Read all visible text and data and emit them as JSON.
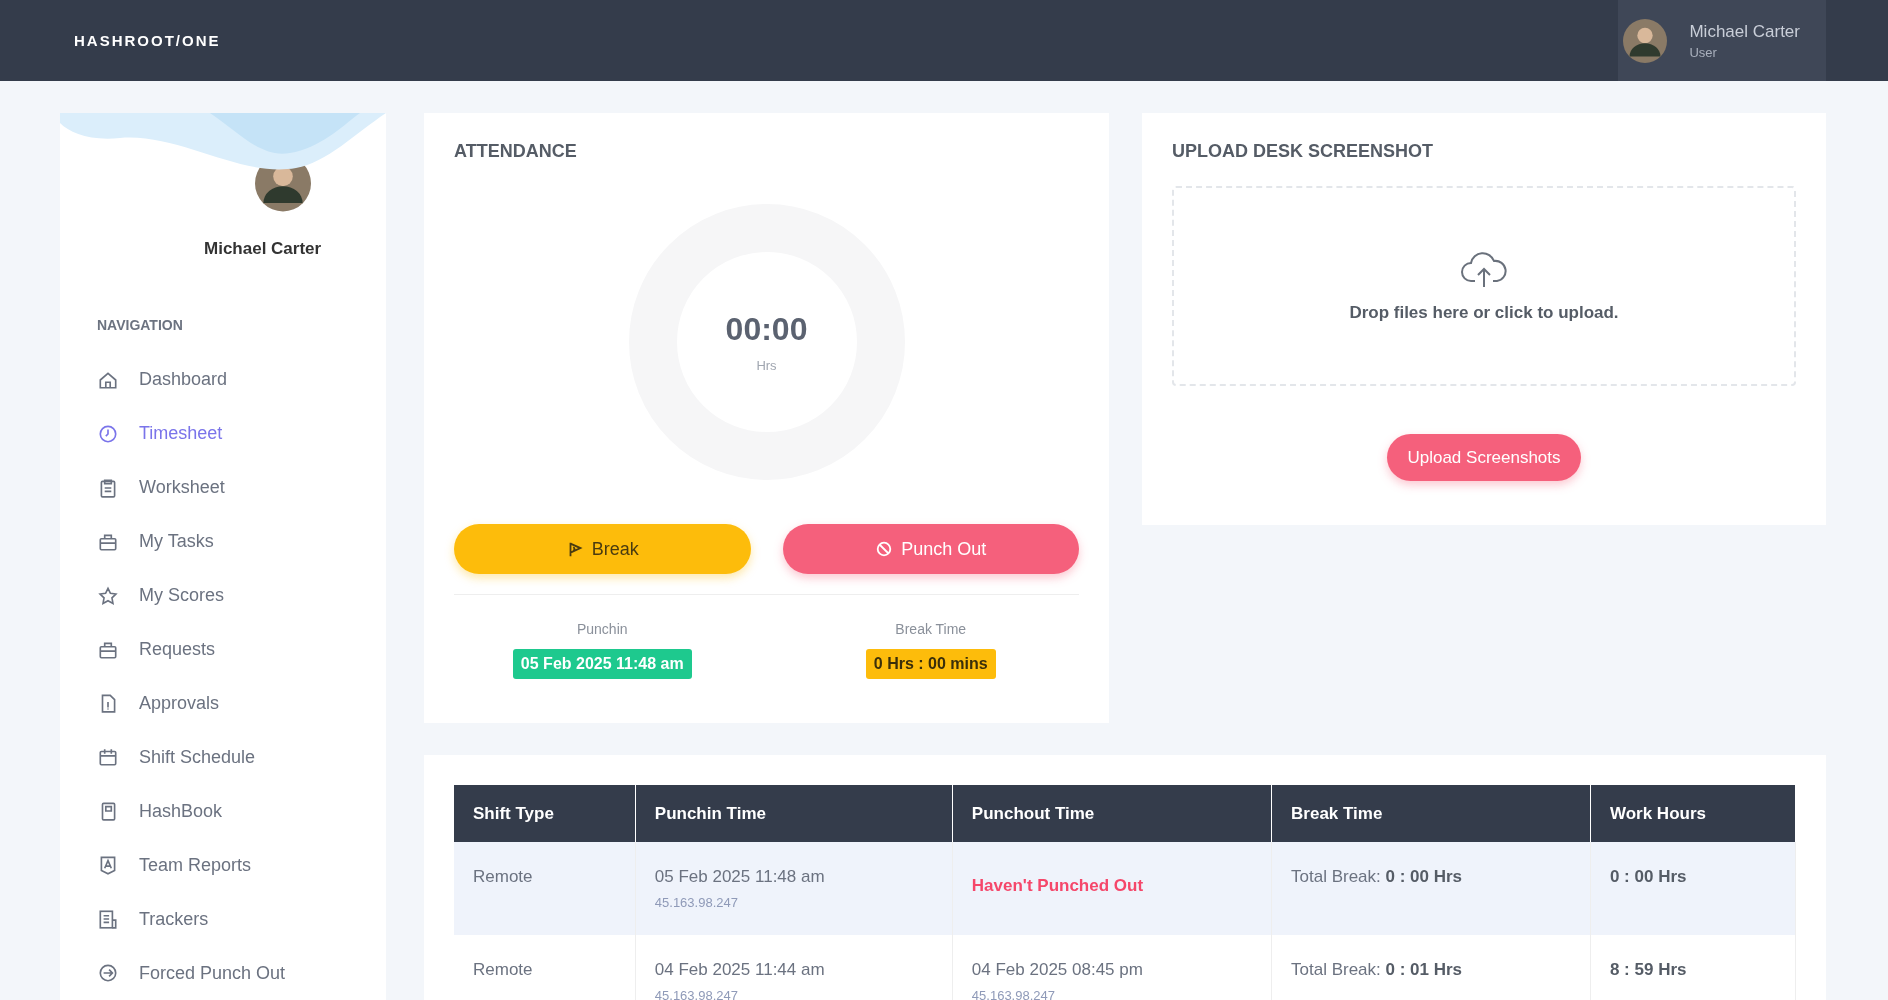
{
  "topbar": {
    "logo": "HASHROOT/ONE",
    "user": {
      "name": "Michael Carter",
      "role": "User"
    }
  },
  "sidebar": {
    "name": "Michael Carter",
    "section": "NAVIGATION",
    "items": [
      {
        "label": "Dashboard",
        "selected": false
      },
      {
        "label": "Timesheet",
        "selected": true
      },
      {
        "label": "Worksheet",
        "selected": false
      },
      {
        "label": "My Tasks",
        "selected": false
      },
      {
        "label": "My Scores",
        "selected": false
      },
      {
        "label": "Requests",
        "selected": false
      },
      {
        "label": "Approvals",
        "selected": false
      },
      {
        "label": "Shift Schedule",
        "selected": false
      },
      {
        "label": "HashBook",
        "selected": false
      },
      {
        "label": "Team Reports",
        "selected": false
      },
      {
        "label": "Trackers",
        "selected": false
      },
      {
        "label": "Forced Punch Out",
        "selected": false
      }
    ]
  },
  "attendance": {
    "title": "ATTENDANCE",
    "timer": "00:00",
    "unit": "Hrs",
    "level": 0,
    "buttons": [
      {
        "label": "Break",
        "kind": "break"
      },
      {
        "label": "Punch Out",
        "kind": "punch"
      }
    ],
    "stats": [
      {
        "label": "Punchin",
        "value": "05 Feb 2025 11:48 am",
        "color": "#1ec98e"
      },
      {
        "label": "Break Time",
        "value": "0 Hrs : 00 mins",
        "color": "#fdbc0b"
      }
    ]
  },
  "upload": {
    "title": "UPLOAD DESK SCREENSHOT",
    "hint": "Drop files here or click to upload.",
    "button": "Upload Screenshots"
  },
  "table": {
    "columns": [
      "Shift Type",
      "Punchin Time",
      "Punchout Time",
      "Break Time",
      "Work Hours"
    ],
    "rows": [
      {
        "selected": true,
        "shift": "Remote",
        "punchin": {
          "time": "05 Feb 2025 11:48 am",
          "ip": "45.163.98.247"
        },
        "punchout": {
          "kind": "pending",
          "text": "Haven't Punched Out"
        },
        "break": "Total Break: **0 : 00 Hrs**",
        "hours": "0 : 00 Hrs"
      },
      {
        "selected": false,
        "shift": "Remote",
        "punchin": {
          "time": "04 Feb 2025 11:44 am",
          "ip": "45.163.98.247"
        },
        "punchout": {
          "kind": "time",
          "text": "04 Feb 2025 08:45 pm",
          "ip": "45.163.98.247"
        },
        "break": "Total Break: **0 : 01 Hrs**",
        "hours": "8 : 59 Hrs"
      }
    ]
  }
}
